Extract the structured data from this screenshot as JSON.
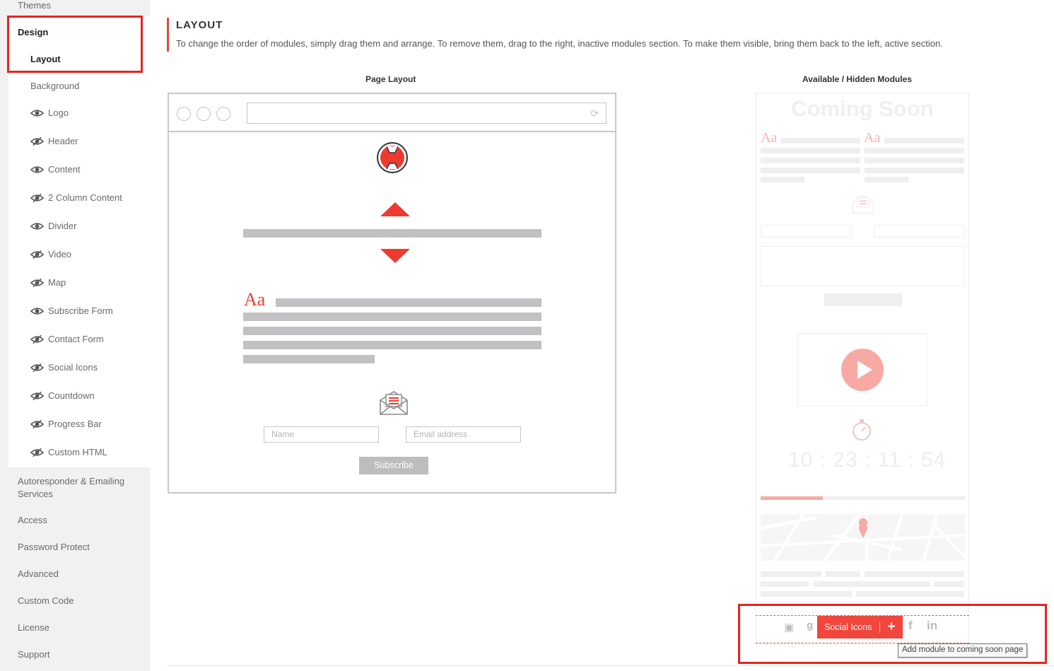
{
  "sidebar": {
    "themes": "Themes",
    "design": "Design",
    "sub_items": [
      {
        "label": "Layout",
        "icon": ""
      },
      {
        "label": "Background",
        "icon": ""
      },
      {
        "label": "Logo",
        "icon": "eye-icon"
      },
      {
        "label": "Header",
        "icon": "eye-slash-icon"
      },
      {
        "label": "Content",
        "icon": "eye-icon"
      },
      {
        "label": "2 Column Content",
        "icon": "eye-slash-icon"
      },
      {
        "label": "Divider",
        "icon": "eye-icon"
      },
      {
        "label": "Video",
        "icon": "eye-slash-icon"
      },
      {
        "label": "Map",
        "icon": "eye-slash-icon"
      },
      {
        "label": "Subscribe Form",
        "icon": "eye-icon"
      },
      {
        "label": "Contact Form",
        "icon": "eye-slash-icon"
      },
      {
        "label": "Social Icons",
        "icon": "eye-slash-icon"
      },
      {
        "label": "Countdown",
        "icon": "eye-slash-icon"
      },
      {
        "label": "Progress Bar",
        "icon": "eye-slash-icon"
      },
      {
        "label": "Custom HTML",
        "icon": "eye-slash-icon"
      }
    ],
    "autoresponder": "Autoresponder & Emailing Services",
    "access": "Access",
    "password_protect": "Password Protect",
    "advanced": "Advanced",
    "custom_code": "Custom Code",
    "license": "License",
    "support": "Support"
  },
  "header": {
    "title": "LAYOUT",
    "description": "To change the order of modules, simply drag them and arrange. To remove them, drag to the right, inactive modules section. To make them visible, bring them back to the left, active section."
  },
  "page_layout": {
    "title": "Page Layout",
    "aa_text": "Aa",
    "name_placeholder": "Name",
    "email_placeholder": "Email address",
    "subscribe_label": "Subscribe"
  },
  "hidden_modules": {
    "title": "Available / Hidden Modules",
    "coming_soon": "Coming Soon",
    "aa_text": "Aa",
    "countdown": "10 : 23 : 11 : 54",
    "social_label": "Social Icons",
    "add_label": "+",
    "tooltip": "Add module to coming soon page"
  },
  "colors": {
    "accent": "#f1463b",
    "highlight": "#e8231f"
  }
}
